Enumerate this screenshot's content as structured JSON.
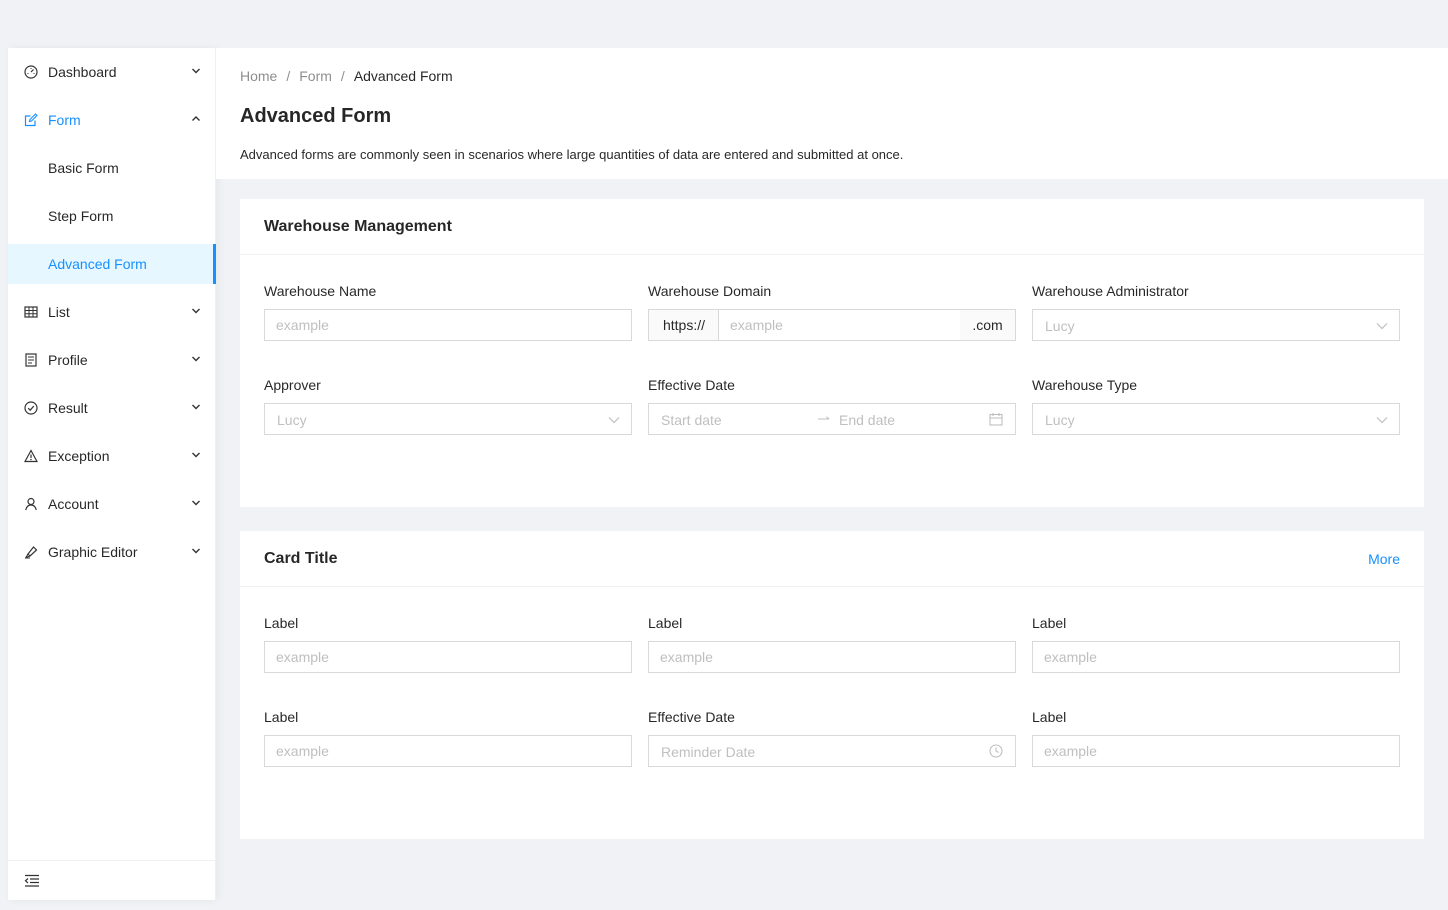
{
  "sidebar": {
    "items": [
      {
        "label": "Dashboard",
        "icon": "dashboard-icon"
      },
      {
        "label": "Form",
        "icon": "form-icon"
      },
      {
        "label": "Basic Form"
      },
      {
        "label": "Step Form"
      },
      {
        "label": "Advanced Form"
      },
      {
        "label": "List",
        "icon": "table-icon"
      },
      {
        "label": "Profile",
        "icon": "profile-icon"
      },
      {
        "label": "Result",
        "icon": "check-circle-icon"
      },
      {
        "label": "Exception",
        "icon": "warning-icon"
      },
      {
        "label": "Account",
        "icon": "user-icon"
      },
      {
        "label": "Graphic Editor",
        "icon": "highlight-icon"
      }
    ],
    "footer_icon": "menu-fold-icon"
  },
  "header": {
    "breadcrumb": [
      "Home",
      "Form",
      "Advanced Form"
    ],
    "separator": "/",
    "title": "Advanced Form",
    "description": "Advanced forms are commonly seen in scenarios where large quantities of data are entered and submitted at once."
  },
  "warehouse_card": {
    "title": "Warehouse Management",
    "name_label": "Warehouse Name",
    "name_placeholder": "example",
    "domain_label": "Warehouse Domain",
    "domain_prefix": "https://",
    "domain_placeholder": "example",
    "domain_suffix": ".com",
    "admin_label": "Warehouse Administrator",
    "admin_value": "Lucy",
    "approver_label": "Approver",
    "approver_value": "Lucy",
    "date_label": "Effective Date",
    "date_start": "Start date",
    "date_end": "End date",
    "type_label": "Warehouse Type",
    "type_value": "Lucy"
  },
  "card2": {
    "title": "Card Title",
    "extra": "More",
    "label1": "Label",
    "label2": "Label",
    "label3": "Label",
    "label4": "Label",
    "date_label": "Effective Date",
    "label6": "Label",
    "placeholder": "example",
    "reminder_placeholder": "Reminder Date"
  },
  "colors": {
    "primary": "#1890ff",
    "selected_bg": "#e6f7ff",
    "page_bg": "#f0f2f5"
  }
}
